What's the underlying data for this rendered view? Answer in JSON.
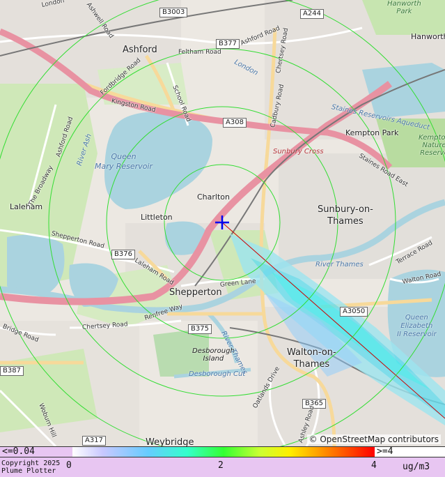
{
  "map": {
    "places": {
      "ashford": "Ashford",
      "charlton": "Charlton",
      "littleton": "Littleton",
      "laleham": "Laleham",
      "shepperton": "Shepperton",
      "sunbury": "Sunbury-on-\nThames",
      "walton": "Walton-on-\nThames",
      "weybridge": "Weybridge",
      "kempton_park": "Kempton Park",
      "hanworth": "Hanworth",
      "hanworth_park": "Hanworth\nPark",
      "sunbury_cross": "Sunbury Cross",
      "desborough_island": "Desborough\nIsland",
      "kempton_nature": "Kempton\nNature\nReserve"
    },
    "water": {
      "queen_mary": "Queen\nMary Reservoir",
      "queen_elizabeth": "Queen\nElizabeth\nII Reservoir",
      "river_thames_1": "River Thames",
      "river_thames_2": "River Thames",
      "desborough_cut": "Desborough Cut",
      "river_ash": "River Ash",
      "staines_aqueduct": "Staines Reservoirs Aqueduct",
      "london": "London"
    },
    "road_refs": {
      "b3003": "B3003",
      "a244": "A244",
      "b377": "B377",
      "a308": "A308",
      "b376": "B376",
      "b375": "B375",
      "a3050": "A3050",
      "b387": "B387",
      "b365": "B365",
      "a317": "A317"
    },
    "road_names": {
      "kingston_road": "Kingston Road",
      "felthan_road": "Feltham Road",
      "school_road": "School Road",
      "fordbridge_road": "Fordbridge Road",
      "ashford_road": "Ashford Road",
      "ashford_road2": "Ashford Road",
      "the_broadway": "The Broadway",
      "shepperton_road": "Shepperton Road",
      "laleham_road": "Laleham Road",
      "green_lane": "Green Lane",
      "chertsey_road": "Chertsey Road",
      "renfree_way": "Renfree Way",
      "bridge_road": "Bridge Road",
      "woburn_hill": "Woburn Hill",
      "oatlands_drive": "Oatlands Drive",
      "ashley_road": "Ashley Road",
      "terrace_road": "Terrace Road",
      "walton_road": "Walton Road",
      "staines_road_east": "Staines Road East",
      "cadbury_road": "Cadbury Road",
      "chertsey_road2": "Chertsey Road",
      "ashwell_road": "Ashwell Road",
      "london_road": "London"
    },
    "attribution": "© OpenStreetMap contributors"
  },
  "legend": {
    "low_label": "<=0.04",
    "high_label": ">=4",
    "tick_0": "0",
    "tick_2": "2",
    "tick_4": "4",
    "units": "ug/m3",
    "copyright": "Copyright 2025",
    "product": "Plume Plotter",
    "colors": {
      "low": "#e8c6f2",
      "mid": "#33ff33",
      "high": "#ff0000",
      "background": "#e8c6f2"
    }
  },
  "plume": {
    "source_marker": "blue-cross",
    "rings": 4,
    "direction": "south-east"
  }
}
